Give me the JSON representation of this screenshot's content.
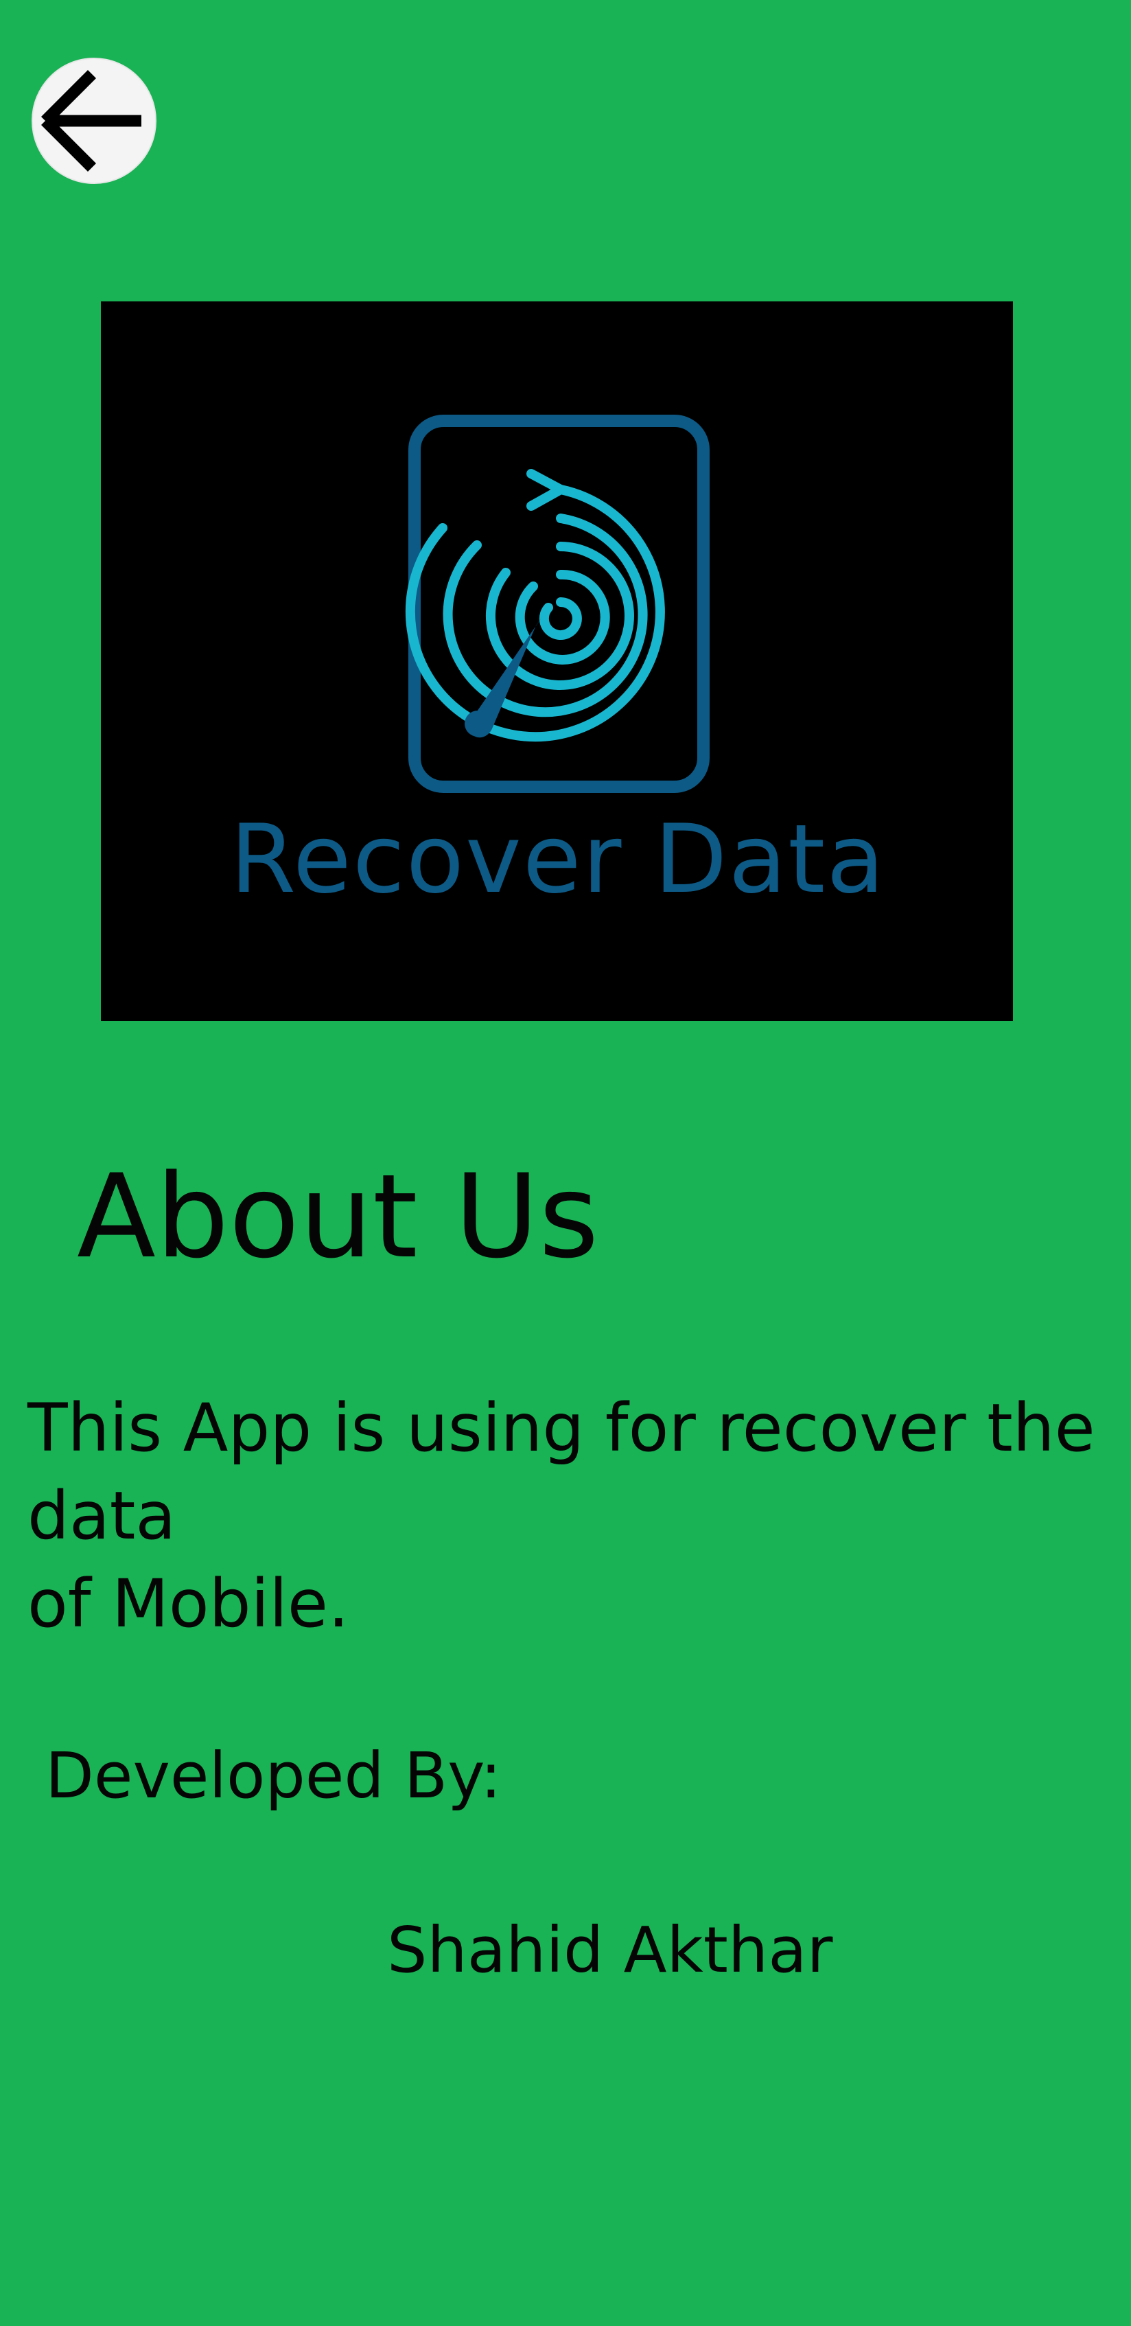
{
  "header": {
    "back_icon": "arrow-left-icon"
  },
  "logo": {
    "icon": "disk-recovery-icon",
    "text": "Recover Data",
    "background": "#000000",
    "frame_color": "#0d5a86",
    "ring_color": "#18b7cf"
  },
  "about": {
    "title": "About Us",
    "description": "This App is using for recover the data\n of Mobile.",
    "developed_label": "Developed By:",
    "developer_name": "Shahid Akthar"
  },
  "theme": {
    "background": "#19b254",
    "text": "#050505"
  }
}
